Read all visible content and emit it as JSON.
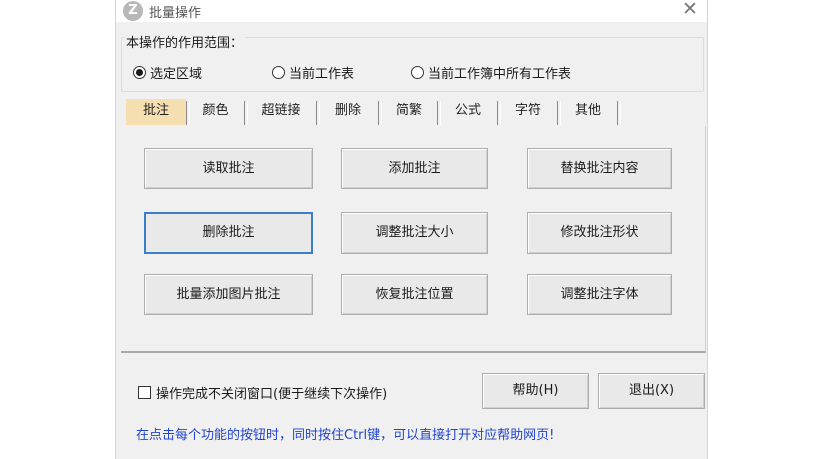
{
  "window": {
    "title": "批量操作",
    "icon_glyph": "Z",
    "close_glyph": "✕"
  },
  "scope": {
    "label": "本操作的作用范围：",
    "options": [
      {
        "label": "选定区域",
        "selected": true
      },
      {
        "label": "当前工作表",
        "selected": false
      },
      {
        "label": "当前工作簿中所有工作表",
        "selected": false
      }
    ]
  },
  "tabs": [
    {
      "label": "批注",
      "active": true
    },
    {
      "label": "颜色",
      "active": false
    },
    {
      "label": "超链接",
      "active": false
    },
    {
      "label": "删除",
      "active": false
    },
    {
      "label": "简繁",
      "active": false
    },
    {
      "label": "公式",
      "active": false
    },
    {
      "label": "字符",
      "active": false
    },
    {
      "label": "其他",
      "active": false
    }
  ],
  "actions": [
    "读取批注",
    "添加批注",
    "替换批注内容",
    "删除批注",
    "调整批注大小",
    "修改批注形状",
    "批量添加图片批注",
    "恢复批注位置",
    "调整批注字体"
  ],
  "footer": {
    "keep_open_label": "操作完成不关闭窗口(便于继续下次操作)",
    "keep_open_checked": false,
    "help_label": "帮助(H)",
    "exit_label": "退出(X)",
    "hint": "在点击每个功能的按钮时，同时按住Ctrl键，可以直接打开对应帮助网页!"
  },
  "colors": {
    "active_tab": "#f5dfb1",
    "focus_border": "#3b7fc8",
    "hint_text": "#2244cc"
  }
}
